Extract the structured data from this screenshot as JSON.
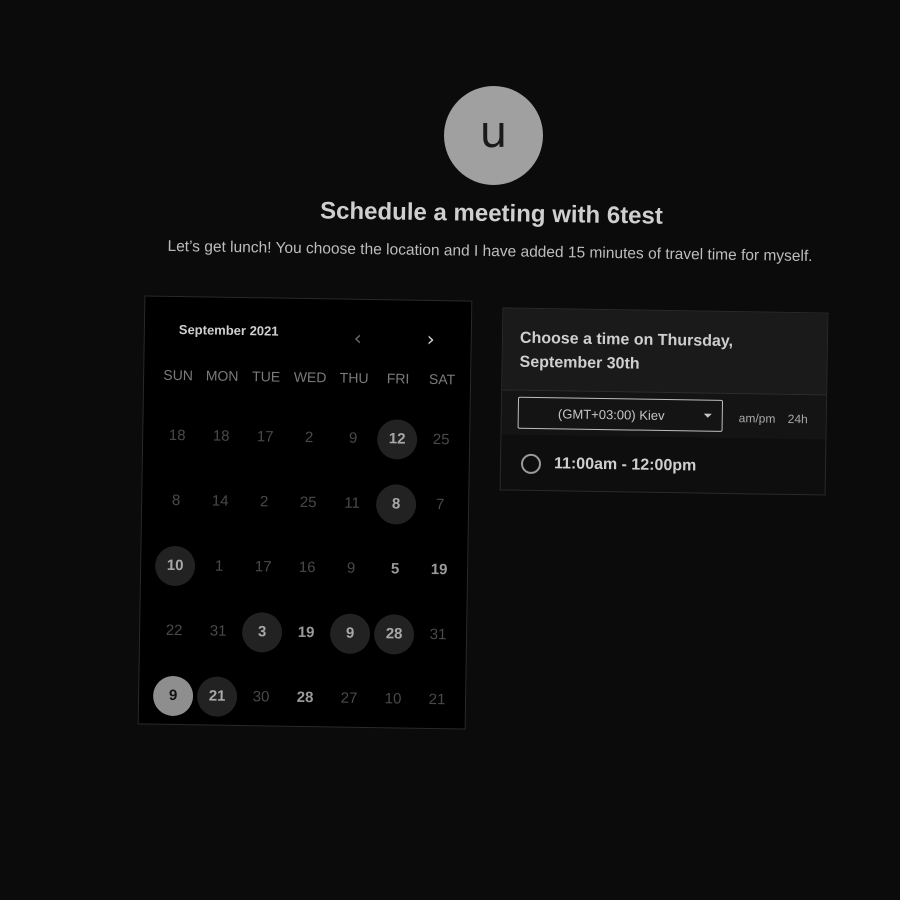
{
  "host": {
    "avatar_initial": "u",
    "title": "Schedule a meeting with 6test",
    "description": "Let’s get lunch! You choose the location and I have added 15 minutes of travel time for myself."
  },
  "calendar": {
    "month_label": "September 2021",
    "prev_icon": "chevron-left-icon",
    "next_icon": "chevron-right-icon",
    "weekdays": [
      "SUN",
      "MON",
      "TUE",
      "WED",
      "THU",
      "FRI",
      "SAT"
    ],
    "weeks": [
      [
        {
          "label": "18",
          "state": "dim"
        },
        {
          "label": "18",
          "state": "dim"
        },
        {
          "label": "17",
          "state": "dim"
        },
        {
          "label": "2",
          "state": "dim"
        },
        {
          "label": "9",
          "state": "dim"
        },
        {
          "label": "12",
          "state": "available"
        },
        {
          "label": "25",
          "state": "dim"
        }
      ],
      [
        {
          "label": "8",
          "state": "dim"
        },
        {
          "label": "14",
          "state": "dim"
        },
        {
          "label": "2",
          "state": "dim"
        },
        {
          "label": "25",
          "state": "dim"
        },
        {
          "label": "11",
          "state": "dim"
        },
        {
          "label": "8",
          "state": "available"
        },
        {
          "label": "7",
          "state": "dim"
        }
      ],
      [
        {
          "label": "10",
          "state": "available"
        },
        {
          "label": "1",
          "state": "dim"
        },
        {
          "label": "17",
          "state": "dim"
        },
        {
          "label": "16",
          "state": "dim"
        },
        {
          "label": "9",
          "state": "dim"
        },
        {
          "label": "5",
          "state": "bold"
        },
        {
          "label": "19",
          "state": "bold"
        }
      ],
      [
        {
          "label": "22",
          "state": "dim"
        },
        {
          "label": "31",
          "state": "dim"
        },
        {
          "label": "3",
          "state": "available"
        },
        {
          "label": "19",
          "state": "bold"
        },
        {
          "label": "9",
          "state": "available"
        },
        {
          "label": "28",
          "state": "available"
        },
        {
          "label": "31",
          "state": "dim"
        }
      ],
      [
        {
          "label": "9",
          "state": "selected"
        },
        {
          "label": "21",
          "state": "available"
        },
        {
          "label": "30",
          "state": "dim"
        },
        {
          "label": "28",
          "state": "bold"
        },
        {
          "label": "27",
          "state": "dim"
        },
        {
          "label": "10",
          "state": "dim"
        },
        {
          "label": "21",
          "state": "dim"
        }
      ]
    ]
  },
  "times": {
    "heading": "Choose a time on Thursday, September 30th",
    "timezone": "(GMT+03:00) Kiev",
    "format_ampm": "am/pm",
    "format_24h": "24h",
    "slots": [
      "11:00am - 12:00pm"
    ]
  }
}
